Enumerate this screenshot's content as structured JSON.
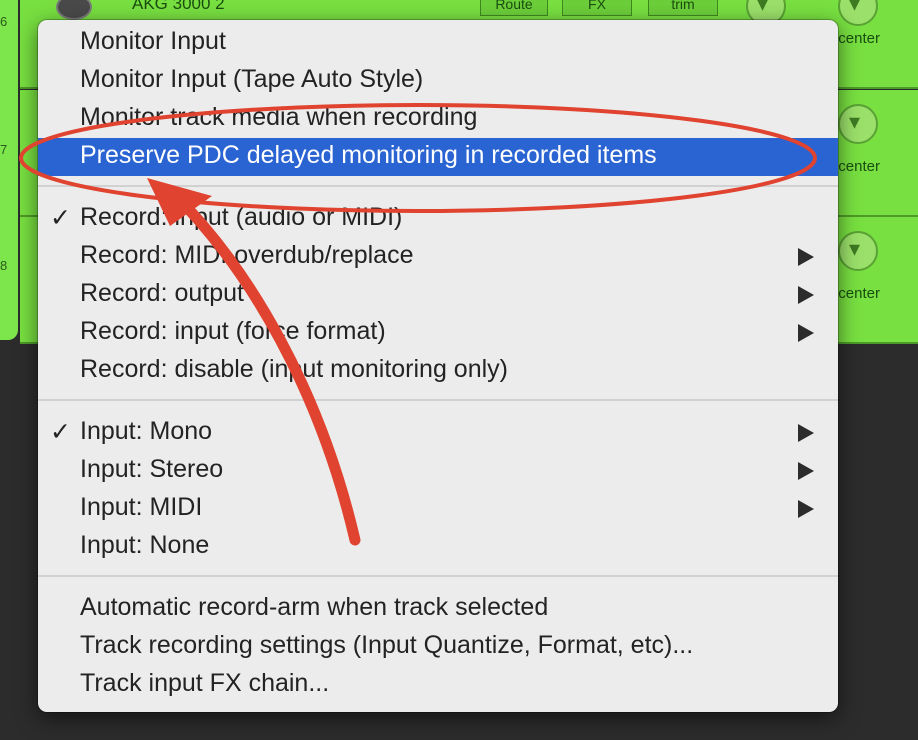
{
  "background": {
    "track_name": "AKG 3000 2",
    "track_numbers": [
      "6",
      "7",
      "8"
    ],
    "route_label": "Route",
    "fx_label": "FX",
    "trim_label": "trim",
    "pan_label": "center"
  },
  "menu": {
    "groups": [
      {
        "items": [
          {
            "label": "Monitor Input",
            "checked": false,
            "submenu": false,
            "highlighted": false
          },
          {
            "label": "Monitor Input (Tape Auto Style)",
            "checked": false,
            "submenu": false,
            "highlighted": false
          },
          {
            "label": "Monitor track media when recording",
            "checked": false,
            "submenu": false,
            "highlighted": false
          },
          {
            "label": "Preserve PDC delayed monitoring in recorded items",
            "checked": false,
            "submenu": false,
            "highlighted": true
          }
        ]
      },
      {
        "items": [
          {
            "label": "Record: input (audio or MIDI)",
            "checked": true,
            "submenu": false,
            "highlighted": false
          },
          {
            "label": "Record: MIDI overdub/replace",
            "checked": false,
            "submenu": true,
            "highlighted": false
          },
          {
            "label": "Record: output",
            "checked": false,
            "submenu": true,
            "highlighted": false
          },
          {
            "label": "Record: input (force format)",
            "checked": false,
            "submenu": true,
            "highlighted": false
          },
          {
            "label": "Record: disable (input monitoring only)",
            "checked": false,
            "submenu": false,
            "highlighted": false
          }
        ]
      },
      {
        "items": [
          {
            "label": "Input: Mono",
            "checked": true,
            "submenu": true,
            "highlighted": false
          },
          {
            "label": "Input: Stereo",
            "checked": false,
            "submenu": true,
            "highlighted": false
          },
          {
            "label": "Input: MIDI",
            "checked": false,
            "submenu": true,
            "highlighted": false
          },
          {
            "label": "Input: None",
            "checked": false,
            "submenu": false,
            "highlighted": false
          }
        ]
      },
      {
        "items": [
          {
            "label": "Automatic record-arm when track selected",
            "checked": false,
            "submenu": false,
            "highlighted": false
          },
          {
            "label": "Track recording settings (Input Quantize, Format, etc)...",
            "checked": false,
            "submenu": false,
            "highlighted": false
          },
          {
            "label": "Track input FX chain...",
            "checked": false,
            "submenu": false,
            "highlighted": false
          }
        ]
      }
    ],
    "check_glyph": "✓"
  },
  "annotation": {
    "color": "#e0432f",
    "shapes": [
      "ellipse-highlight",
      "curved-arrow"
    ]
  }
}
